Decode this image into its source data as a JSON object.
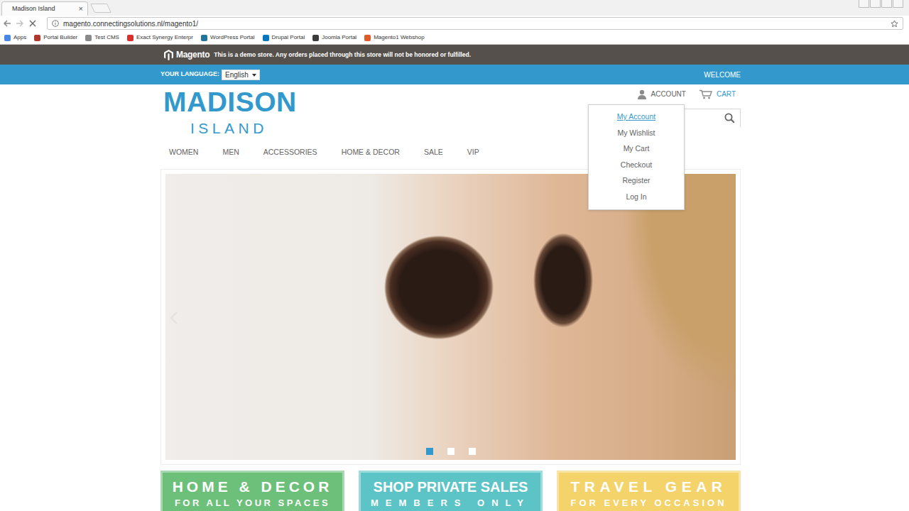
{
  "browser": {
    "tab": {
      "title": "Madison Island",
      "close": "×",
      "selected": true
    },
    "url": "magento.connectingsolutions.nl/magento1/",
    "bookmarks": [
      {
        "label": "Apps",
        "color": "#4a86e8"
      },
      {
        "label": "Portal Builder",
        "color": "#b03a2e"
      },
      {
        "label": "Test CMS",
        "color": "#8a8a8a"
      },
      {
        "label": "Exact Synergy Enterpr",
        "color": "#d9302c"
      },
      {
        "label": "WordPress Portal",
        "color": "#21759b"
      },
      {
        "label": "Drupal Portal",
        "color": "#0077c0"
      },
      {
        "label": "Joomla Portal",
        "color": "#3b3b3b"
      },
      {
        "label": "Magento1 Webshop",
        "color": "#e35a2a"
      }
    ]
  },
  "demo_notice": {
    "logo": "Magento",
    "text": "This is a demo store. Any orders placed through this store will not be honored or fulfilled."
  },
  "top_bar": {
    "language_label": "YOUR LANGUAGE:",
    "language": "English",
    "welcome": "WELCOME"
  },
  "header": {
    "logo_title": "MADISON",
    "logo_subtitle": "ISLAND",
    "account": "ACCOUNT",
    "cart": "CART"
  },
  "account_menu": {
    "expanded": true,
    "items": [
      {
        "label": "My Account",
        "selected": true
      },
      {
        "label": "My Wishlist",
        "selected": false
      },
      {
        "label": "My Cart",
        "selected": false
      },
      {
        "label": "Checkout",
        "selected": false
      },
      {
        "label": "Register",
        "selected": false
      },
      {
        "label": "Log In",
        "selected": false
      }
    ]
  },
  "nav": [
    {
      "label": "WOMEN"
    },
    {
      "label": "MEN"
    },
    {
      "label": "ACCESSORIES"
    },
    {
      "label": "HOME & DECOR"
    },
    {
      "label": "SALE"
    },
    {
      "label": "VIP"
    }
  ],
  "slideshow": {
    "slides": [
      {
        "selected": true
      },
      {
        "selected": false
      },
      {
        "selected": false
      }
    ]
  },
  "promos": [
    {
      "title": "HOME & DECOR",
      "subtitle": "FOR ALL YOUR SPACES",
      "color": "#6cc07a"
    },
    {
      "title": "SHOP PRIVATE SALES",
      "subtitle": "MEMBERS ONLY",
      "color": "#5cc3c6"
    },
    {
      "title": "TRAVEL GEAR",
      "subtitle": "FOR EVERY OCCASION",
      "color": "#f3d36a"
    }
  ]
}
